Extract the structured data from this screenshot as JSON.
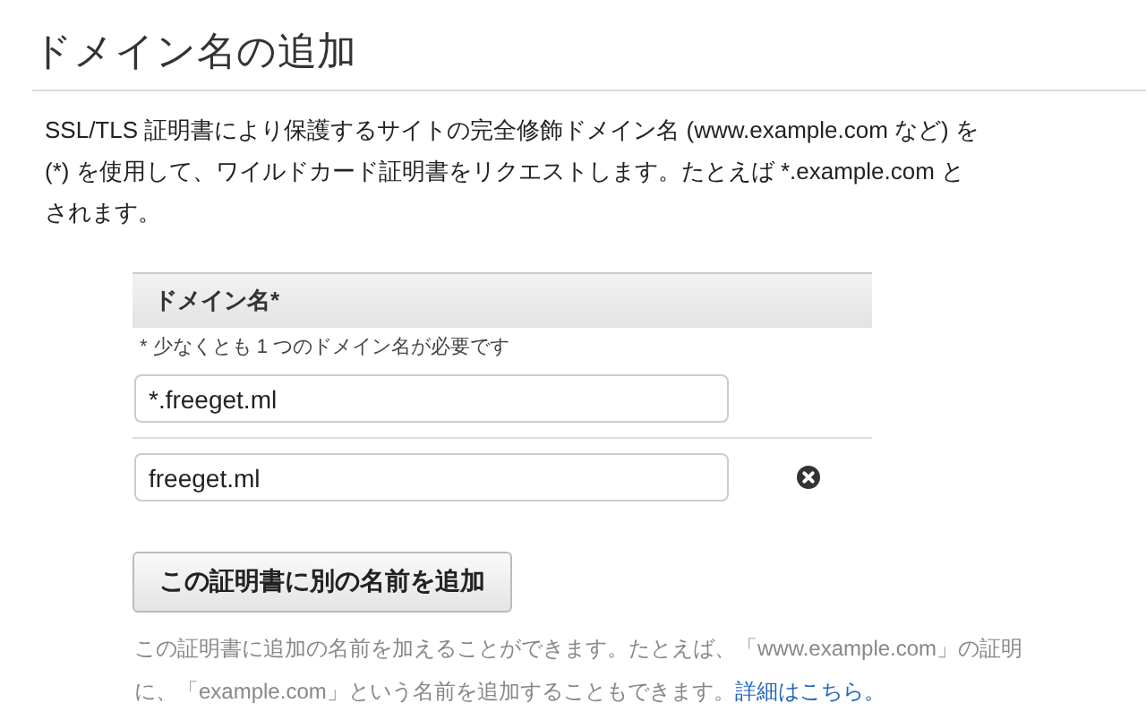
{
  "title": "ドメイン名の追加",
  "intro_lines": [
    "SSL/TLS 証明書により保護するサイトの完全修飾ドメイン名 (www.example.com など) を",
    "(*) を使用して、ワイルドカード証明書をリクエストします。たとえば *.example.com と",
    "されます。"
  ],
  "domain_table": {
    "header": "ドメイン名*",
    "hint": "* 少なくとも 1 つのドメイン名が必要です",
    "rows": [
      {
        "value": "*.freeget.ml",
        "removable": false
      },
      {
        "value": "freeget.ml",
        "removable": true
      }
    ]
  },
  "add_button": "この証明書に別の名前を追加",
  "help_lines": [
    "この証明書に追加の名前を加えることができます。たとえば、「www.example.com」の証明",
    "に、「example.com」という名前を追加することもできます。"
  ],
  "help_link": "詳細はこちら。"
}
